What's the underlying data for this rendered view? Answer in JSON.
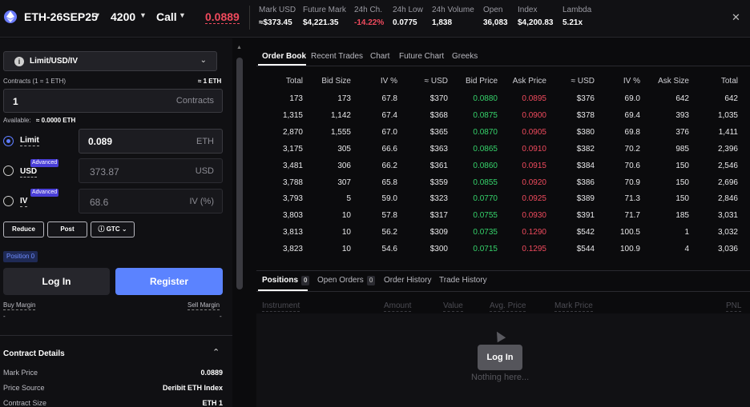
{
  "header": {
    "instrument": "ETH-26SEP25",
    "strike": "4200",
    "option_type": "Call",
    "price": "0.0889",
    "stats": [
      {
        "label": "Mark USD",
        "value": "≈$373.45",
        "tone": "normal"
      },
      {
        "label": "Future Mark",
        "value": "$4,221.35",
        "tone": "normal"
      },
      {
        "label": "24h Ch.",
        "value": "-14.22%",
        "tone": "neg"
      },
      {
        "label": "24h Low",
        "value": "0.0775",
        "tone": "normal"
      },
      {
        "label": "24h Volume",
        "value": "1,838",
        "tone": "normal"
      },
      {
        "label": "Open",
        "value": "36,083",
        "tone": "normal"
      },
      {
        "label": "Index",
        "value": "$4,200.83",
        "tone": "normal"
      },
      {
        "label": "Lambda",
        "value": "5.21x",
        "tone": "normal"
      }
    ],
    "close_icon": "✕"
  },
  "order_form": {
    "mode_select": "Limit/USD/IV",
    "contracts_label": "Contracts (1 = 1 ETH)",
    "contracts_eq": "≈ 1 ETH",
    "contracts_value": "1",
    "contracts_unit": "Contracts",
    "available_label": "Available:",
    "available_value": "≈ 0.0000 ETH",
    "limit_label": "Limit",
    "limit_value": "0.089",
    "limit_unit": "ETH",
    "usd_label": "USD",
    "usd_value": "373.87",
    "usd_unit": "USD",
    "iv_label": "IV",
    "iv_value": "68.6",
    "iv_unit": "IV (%)",
    "advanced_label": "Advanced",
    "reduce_label": "Reduce",
    "post_label": "Post",
    "tif_label": "GTC",
    "position_badge": "Position 0",
    "login_label": "Log In",
    "register_label": "Register",
    "buy_margin_label": "Buy Margin",
    "buy_margin_value": "-",
    "sell_margin_label": "Sell Margin",
    "sell_margin_value": "-"
  },
  "contract_details": {
    "title": "Contract Details",
    "rows": [
      {
        "label": "Mark Price",
        "value": "0.0889"
      },
      {
        "label": "Price Source",
        "value": "Deribit ETH Index"
      },
      {
        "label": "Contract Size",
        "value": "ETH 1"
      }
    ]
  },
  "orderbook": {
    "tabs": [
      "Order Book",
      "Recent Trades",
      "Chart",
      "Future Chart",
      "Greeks"
    ],
    "headers": [
      "Total",
      "Bid Size",
      "IV %",
      "≈ USD",
      "Bid Price",
      "Ask Price",
      "≈ USD",
      "IV %",
      "Ask Size",
      "Total"
    ],
    "rows": [
      [
        "173",
        "173",
        "67.8",
        "$370",
        "0.0880",
        "0.0895",
        "$376",
        "69.0",
        "642",
        "642"
      ],
      [
        "1,315",
        "1,142",
        "67.4",
        "$368",
        "0.0875",
        "0.0900",
        "$378",
        "69.4",
        "393",
        "1,035"
      ],
      [
        "2,870",
        "1,555",
        "67.0",
        "$365",
        "0.0870",
        "0.0905",
        "$380",
        "69.8",
        "376",
        "1,411"
      ],
      [
        "3,175",
        "305",
        "66.6",
        "$363",
        "0.0865",
        "0.0910",
        "$382",
        "70.2",
        "985",
        "2,396"
      ],
      [
        "3,481",
        "306",
        "66.2",
        "$361",
        "0.0860",
        "0.0915",
        "$384",
        "70.6",
        "150",
        "2,546"
      ],
      [
        "3,788",
        "307",
        "65.8",
        "$359",
        "0.0855",
        "0.0920",
        "$386",
        "70.9",
        "150",
        "2,696"
      ],
      [
        "3,793",
        "5",
        "59.0",
        "$323",
        "0.0770",
        "0.0925",
        "$389",
        "71.3",
        "150",
        "2,846"
      ],
      [
        "3,803",
        "10",
        "57.8",
        "$317",
        "0.0755",
        "0.0930",
        "$391",
        "71.7",
        "185",
        "3,031"
      ],
      [
        "3,813",
        "10",
        "56.2",
        "$309",
        "0.0735",
        "0.1290",
        "$542",
        "100.5",
        "1",
        "3,032"
      ],
      [
        "3,823",
        "10",
        "54.6",
        "$300",
        "0.0715",
        "0.1295",
        "$544",
        "100.9",
        "4",
        "3,036"
      ]
    ]
  },
  "positions": {
    "tabs": [
      {
        "label": "Positions",
        "count": "0"
      },
      {
        "label": "Open Orders",
        "count": "0"
      },
      {
        "label": "Order History",
        "count": ""
      },
      {
        "label": "Trade History",
        "count": ""
      }
    ],
    "headers": [
      "Instrument",
      "Amount",
      "Value",
      "Avg. Price",
      "Mark Price",
      "PNL"
    ],
    "login_label": "Log In",
    "empty_text": "Nothing here..."
  },
  "colors": {
    "bid": "#36d36b",
    "ask": "#f04a5d",
    "accent": "#5b83ff"
  }
}
